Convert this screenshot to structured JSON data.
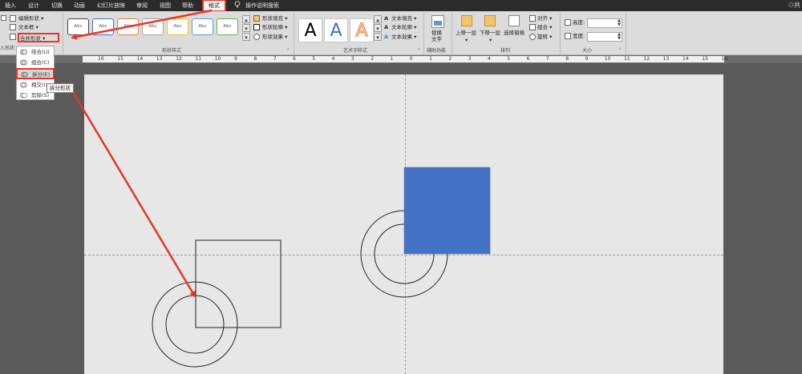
{
  "tabs": [
    {
      "label": "插入"
    },
    {
      "label": "设计"
    },
    {
      "label": "切换"
    },
    {
      "label": "动画"
    },
    {
      "label": "幻灯片放映"
    },
    {
      "label": "审阅"
    },
    {
      "label": "视图"
    },
    {
      "label": "帮助"
    }
  ],
  "active_tab": {
    "label": "格式"
  },
  "tell_me": {
    "label": "操作说明搜索"
  },
  "user": {
    "label": "共"
  },
  "insert_shapes": {
    "edit_shape": "编辑形状",
    "text_box": "文本框",
    "merge_shapes": "合并形状",
    "partial_label": "入形状"
  },
  "merge_menu": {
    "items": [
      {
        "label": "结合(U)"
      },
      {
        "label": "组合(C)"
      },
      {
        "label": "拆分(E)"
      },
      {
        "label": "相交(I)"
      },
      {
        "label": "剪除(S)"
      }
    ],
    "tooltip": "拆分形状"
  },
  "shape_styles": {
    "swatch_text": "Abc",
    "swatch_colors": [
      "#444444",
      "#4472c4",
      "#ed7d31",
      "#a5a5a5",
      "#ffc000",
      "#5b9bd5",
      "#70ad47"
    ],
    "fill": "形状填充",
    "outline": "形状轮廓",
    "effects": "形状效果",
    "label": "形状样式"
  },
  "wordart": {
    "letter": "A",
    "colors": [
      "#000000",
      "#4472c4",
      "#ed7d31"
    ],
    "text_fill": "文本填充",
    "text_outline": "文本轮廓",
    "text_effects": "文本效果",
    "label": "艺术字样式"
  },
  "accessibility": {
    "alt_text_line1": "替换",
    "alt_text_line2": "文字",
    "label": "辅助功能"
  },
  "arrange": {
    "bring_forward": "上移一层",
    "send_backward": "下移一层",
    "selection_pane": "选择窗格",
    "align": "对齐",
    "group": "组合",
    "rotate": "旋转",
    "label": "排列"
  },
  "size": {
    "height_label": "高度:",
    "width_label": "宽度:",
    "height_value": "",
    "width_value": "",
    "label": "大小"
  },
  "ruler": {
    "numbers": [
      "16",
      "15",
      "14",
      "13",
      "12",
      "11",
      "10",
      "9",
      "8",
      "7",
      "6",
      "5",
      "4",
      "3",
      "2",
      "1",
      "0",
      "1",
      "2",
      "3",
      "4",
      "5",
      "6",
      "7",
      "8",
      "9",
      "10",
      "11",
      "12",
      "13",
      "14",
      "15",
      "16"
    ]
  },
  "colors": {
    "accent_red": "#e8352a",
    "shape_blue": "#4472c4",
    "canvas_bg": "#e7e7e7"
  }
}
